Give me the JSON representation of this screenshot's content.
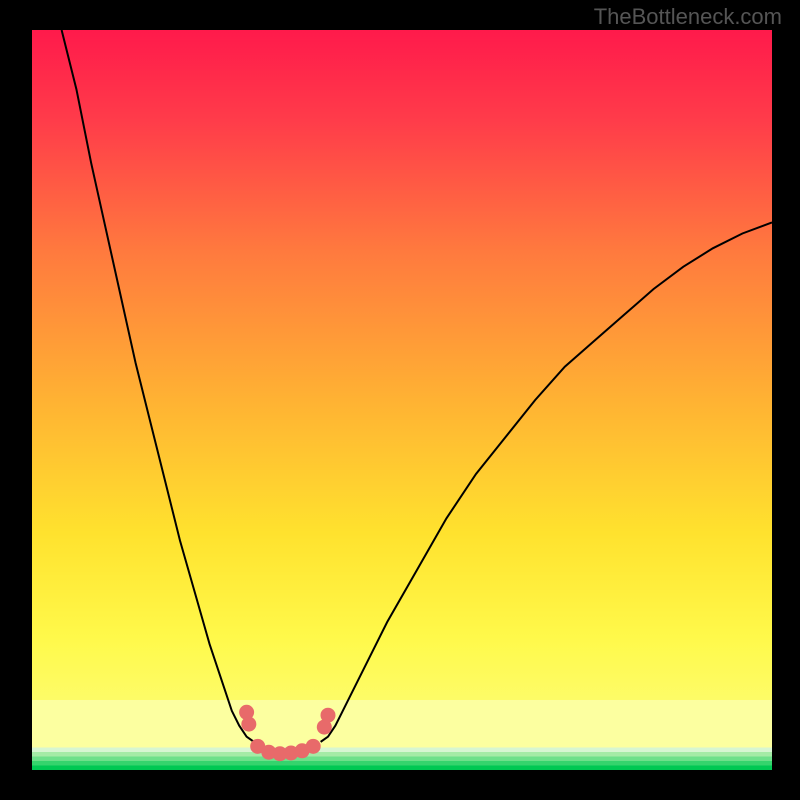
{
  "watermark": "TheBottleneck.com",
  "chart_data": {
    "type": "line",
    "title": "",
    "xlabel": "",
    "ylabel": "",
    "xlim": [
      0,
      100
    ],
    "ylim": [
      0,
      100
    ],
    "series": [
      {
        "name": "left-curve",
        "x": [
          4,
          6,
          8,
          10,
          12,
          14,
          16,
          18,
          20,
          22,
          24,
          26,
          27,
          28,
          29,
          30
        ],
        "values": [
          100,
          92,
          82,
          73,
          64,
          55,
          47,
          39,
          31,
          24,
          17,
          11,
          8,
          6,
          4.5,
          3.8
        ]
      },
      {
        "name": "right-curve",
        "x": [
          39,
          40,
          41,
          42,
          44,
          48,
          52,
          56,
          60,
          64,
          68,
          72,
          76,
          80,
          84,
          88,
          92,
          96,
          100
        ],
        "values": [
          3.8,
          4.5,
          6,
          8,
          12,
          20,
          27,
          34,
          40,
          45,
          50,
          54.5,
          58,
          61.5,
          65,
          68,
          70.5,
          72.5,
          74
        ]
      }
    ],
    "markers": {
      "name": "dots",
      "color": "#e86a6a",
      "points": [
        {
          "x": 29.0,
          "y": 7.8
        },
        {
          "x": 29.3,
          "y": 6.2
        },
        {
          "x": 30.5,
          "y": 3.2
        },
        {
          "x": 32.0,
          "y": 2.4
        },
        {
          "x": 33.5,
          "y": 2.2
        },
        {
          "x": 35.0,
          "y": 2.3
        },
        {
          "x": 36.5,
          "y": 2.6
        },
        {
          "x": 38.0,
          "y": 3.2
        },
        {
          "x": 39.5,
          "y": 5.8
        },
        {
          "x": 40.0,
          "y": 7.4
        }
      ]
    },
    "green_bands": {
      "center_y": 2.5,
      "colors_bottom_to_top": [
        "#00c853",
        "#35d46d",
        "#6de08a",
        "#a4eba6",
        "#d7f6d2"
      ]
    }
  }
}
